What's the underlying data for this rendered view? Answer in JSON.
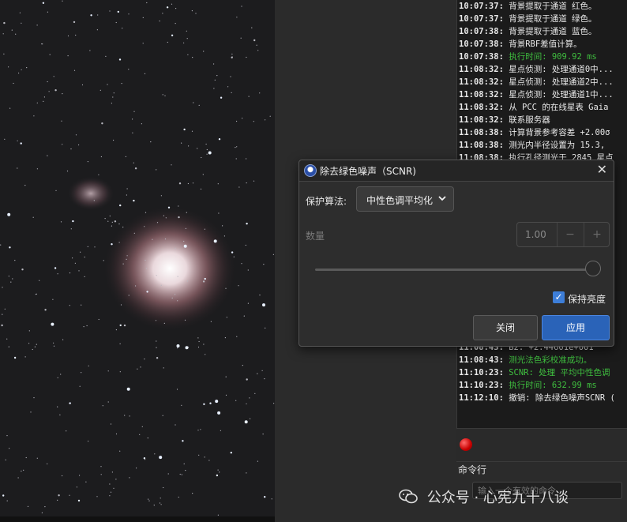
{
  "console": {
    "lines": [
      {
        "time": "10:07:37:",
        "msg": "背景提取于通道 红色。",
        "green": false
      },
      {
        "time": "10:07:37:",
        "msg": "背景提取于通道 绿色。",
        "green": false
      },
      {
        "time": "10:07:38:",
        "msg": "背景提取于通道 蓝色。",
        "green": false
      },
      {
        "time": "10:07:38:",
        "msg": "背景RBF差值计算。",
        "green": false
      },
      {
        "time": "10:07:38:",
        "msg": "执行时间: 909.92 ms",
        "green": true
      },
      {
        "time": "11:08:32:",
        "msg": "星点侦测: 处理通道0中...",
        "green": false
      },
      {
        "time": "11:08:32:",
        "msg": "星点侦测: 处理通道2中...",
        "green": false
      },
      {
        "time": "11:08:32:",
        "msg": "星点侦测: 处理通道1中...",
        "green": false
      },
      {
        "time": "11:08:32:",
        "msg": "从 PCC 的在线星表 Gaia",
        "green": false
      },
      {
        "time": "11:08:32:",
        "msg": "联系服务器",
        "green": false
      },
      {
        "time": "11:08:38:",
        "msg": "计算背景参考容差 +2.00σ",
        "green": false
      },
      {
        "time": "11:08:38:",
        "msg": "测光内半径设置为 15.3,",
        "green": false
      },
      {
        "time": "11:08:38:",
        "msg": "执行孔径测光于 2845 星点",
        "green": false
      },
      {
        "time": "",
        "msg": "",
        "green": false
      },
      {
        "time": "",
        "msg": "",
        "green": false
      },
      {
        "time": "",
        "msg": "",
        "green": false
      },
      {
        "time": "",
        "msg": "",
        "green": false
      },
      {
        "time": "",
        "msg": "",
        "green": false
      },
      {
        "time": "",
        "msg": "",
        "green": false
      },
      {
        "time": "",
        "msg": "",
        "green": false
      },
      {
        "time": "",
        "msg": "",
        "green": false
      },
      {
        "time": "",
        "msg": "",
        "green": false
      },
      {
        "time": "",
        "msg": "",
        "green": false
      },
      {
        "time": "",
        "msg": "",
        "green": false
      },
      {
        "time": "",
        "msg": "",
        "green": false
      },
      {
        "time": "",
        "msg": "",
        "green": false
      },
      {
        "time": "",
        "msg": "",
        "green": false
      },
      {
        "time": "11:08:43:",
        "msg": "B2: +2.44601e+001",
        "green": false
      },
      {
        "time": "11:08:43:",
        "msg": "测光法色彩校准成功。",
        "green": true
      },
      {
        "time": "11:10:23:",
        "msg": "SCNR: 处理 平均中性色调",
        "green": true
      },
      {
        "time": "11:10:23:",
        "msg": "执行时间: 632.99 ms",
        "green": true
      },
      {
        "time": "11:12:10:",
        "msg": "撤销: 除去绿色噪声SCNR (",
        "green": false
      }
    ],
    "command_label": "命令行",
    "command_placeholder": "输入一个有效的命令"
  },
  "dialog": {
    "title": "除去绿色噪声（SCNR)",
    "close_glyph": "✕",
    "algorithm_label": "保护算法:",
    "algorithm_value": "中性色调平均化",
    "amount_label": "数量",
    "amount_value": "1.00",
    "minus_glyph": "−",
    "plus_glyph": "+",
    "slider_value": 1.0,
    "keep_lightness_label": "保持亮度",
    "keep_lightness_checked": true,
    "close_button": "关闭",
    "apply_button": "应用"
  },
  "watermark": {
    "text": "公众号 · 心宪九十八谈"
  },
  "colors": {
    "accent": "#2a63b8",
    "log_green": "#3fbf3f",
    "stop_red": "#d00000"
  }
}
